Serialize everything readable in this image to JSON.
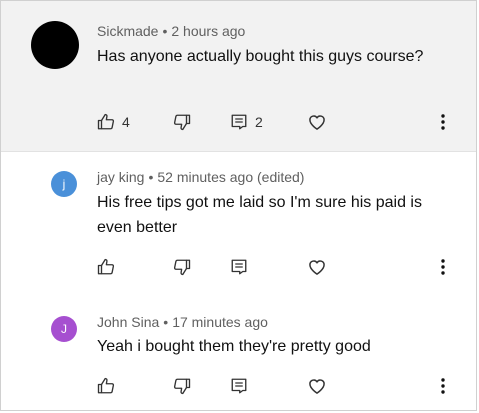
{
  "comments": [
    {
      "author": "Sickmade",
      "separator": "•",
      "time": "2 hours ago",
      "text": "Has anyone actually bought this guys course?",
      "avatar_letter": "",
      "avatar_color": "#000000",
      "likes": "4",
      "replies": "2"
    },
    {
      "author": "jay king",
      "separator": "•",
      "time": "52 minutes ago (edited)",
      "text": "His free tips got me laid so I'm sure his paid is even better",
      "avatar_letter": "j",
      "avatar_color": "#4a90d9",
      "likes": "",
      "replies": ""
    },
    {
      "author": "John Sina",
      "separator": "•",
      "time": "17 minutes ago",
      "text": "Yeah i bought them they're pretty good",
      "avatar_letter": "J",
      "avatar_color": "#a64fd0",
      "likes": "",
      "replies": ""
    }
  ],
  "icons": {
    "like": "thumbs-up-icon",
    "dislike": "thumbs-down-icon",
    "reply": "reply-comment-icon",
    "heart": "heart-icon",
    "more": "more-vertical-icon"
  }
}
